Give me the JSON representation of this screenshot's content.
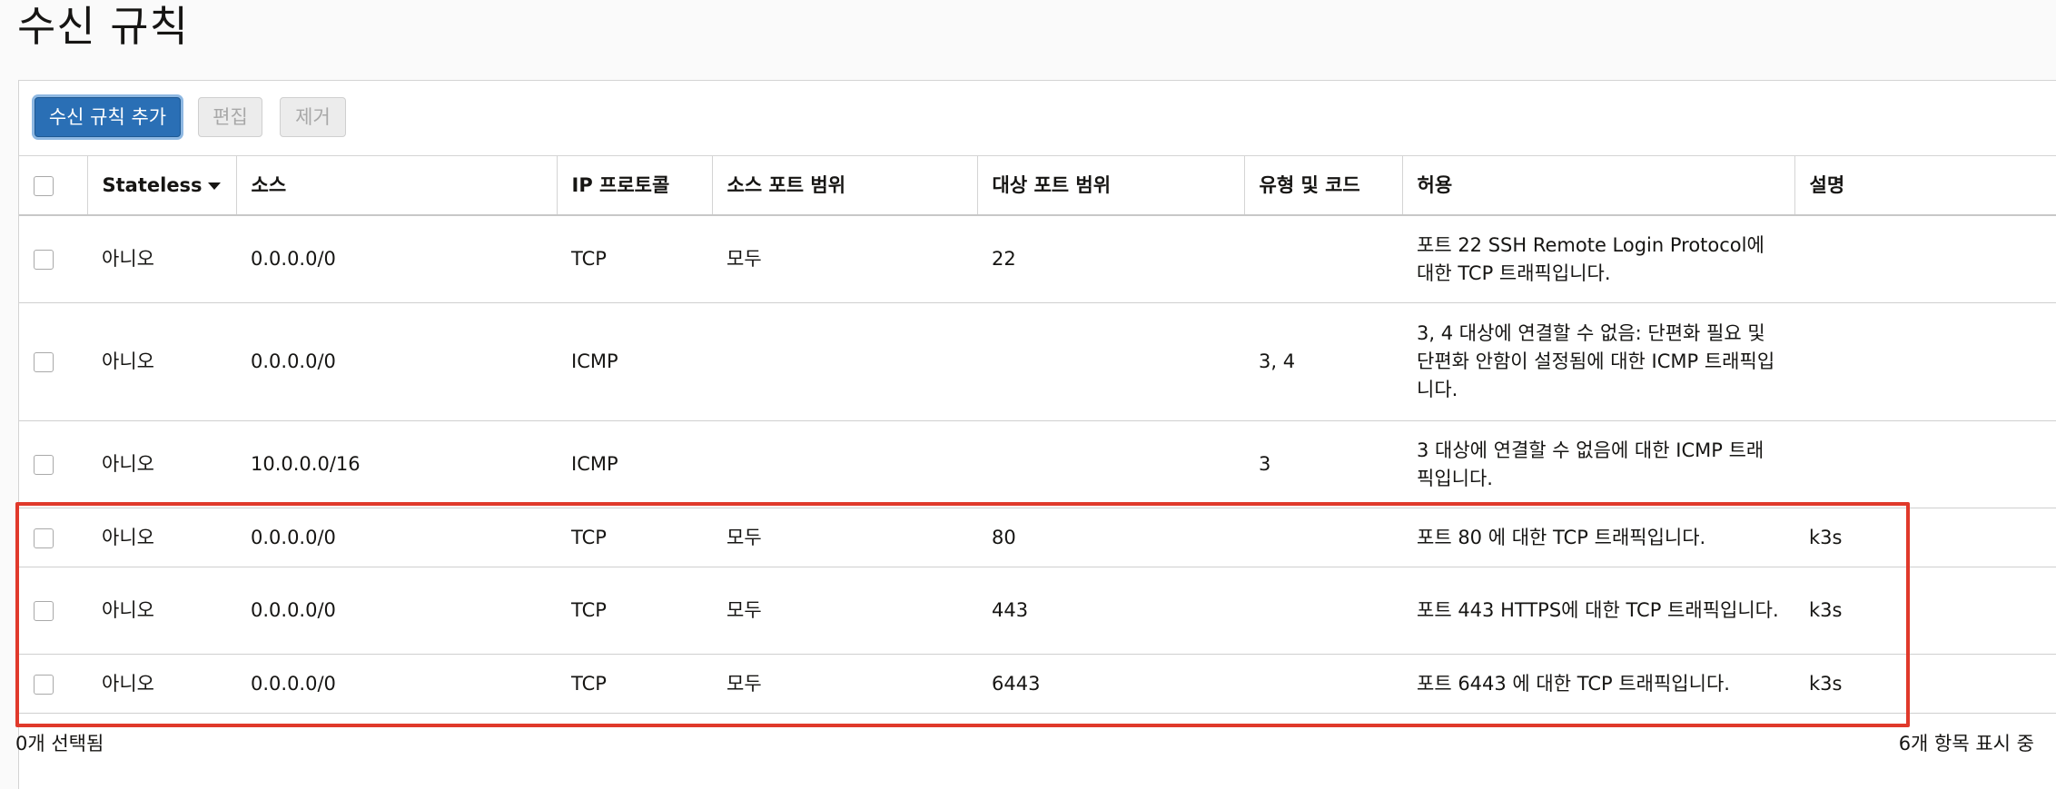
{
  "page": {
    "title": "수신 규칙"
  },
  "toolbar": {
    "add_label": "수신 규칙 추가",
    "edit_label": "편집",
    "remove_label": "제거"
  },
  "table": {
    "headers": {
      "stateless": "Stateless",
      "source": "소스",
      "protocol": "IP 프로토콜",
      "source_port": "소스 포트 범위",
      "dest_port": "대상 포트 범위",
      "type_code": "유형 및 코드",
      "allow": "허용",
      "description": "설명"
    },
    "rows": [
      {
        "stateless": "아니오",
        "source": "0.0.0.0/0",
        "protocol": "TCP",
        "source_port": "모두",
        "dest_port": "22",
        "type_code": "",
        "allow": "포트 22 SSH Remote Login Protocol에 대한 TCP 트래픽입니다.",
        "description": ""
      },
      {
        "stateless": "아니오",
        "source": "0.0.0.0/0",
        "protocol": "ICMP",
        "source_port": "",
        "dest_port": "",
        "type_code": "3, 4",
        "allow": "3, 4 대상에 연결할 수 없음: 단편화 필요 및 단편화 안함이 설정됨에 대한 ICMP 트래픽입니다.",
        "description": ""
      },
      {
        "stateless": "아니오",
        "source": "10.0.0.0/16",
        "protocol": "ICMP",
        "source_port": "",
        "dest_port": "",
        "type_code": "3",
        "allow": "3 대상에 연결할 수 없음에 대한 ICMP 트래픽입니다.",
        "description": ""
      },
      {
        "stateless": "아니오",
        "source": "0.0.0.0/0",
        "protocol": "TCP",
        "source_port": "모두",
        "dest_port": "80",
        "type_code": "",
        "allow": "포트 80 에 대한 TCP 트래픽입니다.",
        "description": "k3s"
      },
      {
        "stateless": "아니오",
        "source": "0.0.0.0/0",
        "protocol": "TCP",
        "source_port": "모두",
        "dest_port": "443",
        "type_code": "",
        "allow": "포트 443 HTTPS에 대한 TCP 트래픽입니다.",
        "description": "k3s"
      },
      {
        "stateless": "아니오",
        "source": "0.0.0.0/0",
        "protocol": "TCP",
        "source_port": "모두",
        "dest_port": "6443",
        "type_code": "",
        "allow": "포트 6443 에 대한 TCP 트래픽입니다.",
        "description": "k3s"
      }
    ]
  },
  "footer": {
    "selected": "0개 선택됨",
    "showing": "6개 항목 표시 중"
  },
  "colors": {
    "primary_button": "#2a6fb5",
    "highlight_border": "#e0392b"
  },
  "icons": {
    "sort": "caret-down-icon",
    "checkbox": "checkbox-icon"
  }
}
